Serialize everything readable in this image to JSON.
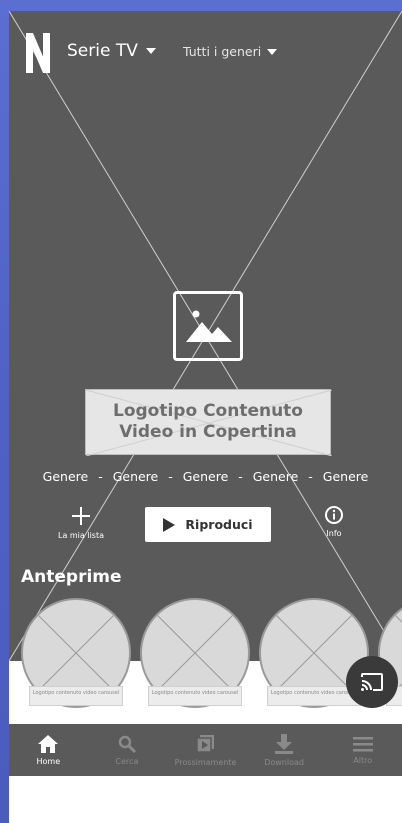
{
  "header": {
    "brand_letter": "N",
    "series_menu": "Serie TV",
    "genres_menu": "Tutti i generi"
  },
  "hero": {
    "title_line1": "Logotipo Contenuto",
    "title_line2": "Video in  Copertina",
    "genres": [
      "Genere",
      "Genere",
      "Genere",
      "Genere",
      "Genere"
    ],
    "separator": "-",
    "my_list_label": "La mia lista",
    "play_label": "Riproduci",
    "info_label": "Info"
  },
  "previews": {
    "title": "Anteprime",
    "items": [
      {
        "label": "Logotipo contenuto video carousel"
      },
      {
        "label": "Logotipo contenuto video carousel"
      },
      {
        "label": "Logotipo contenuto video carousel"
      },
      {
        "label": "L"
      }
    ]
  },
  "nav": {
    "items": [
      {
        "label": "Home",
        "icon": "home-icon",
        "active": true
      },
      {
        "label": "Cerca",
        "icon": "search-icon",
        "active": false
      },
      {
        "label": "Prossimamente",
        "icon": "coming-soon-icon",
        "active": false
      },
      {
        "label": "Download",
        "icon": "download-icon",
        "active": false
      },
      {
        "label": "Altro",
        "icon": "menu-icon",
        "active": false
      }
    ]
  },
  "colors": {
    "hero_bg": "#5a5a5a",
    "nav_bg": "#5a5a5a",
    "placeholder_bg": "#d9d9d9",
    "outer_bg": "#5065c8"
  }
}
